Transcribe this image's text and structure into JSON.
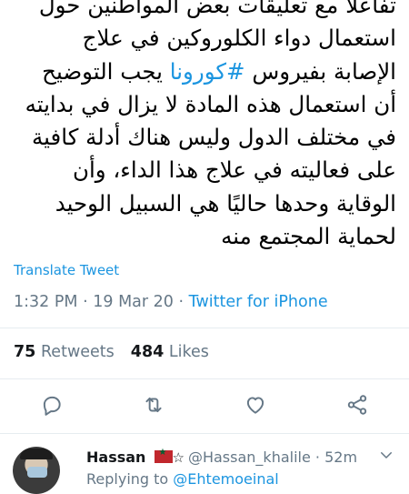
{
  "tweet": {
    "text_before_hashtag": "تفاعلا مع تعليقات بعض المواطنين حول استعمال دواء الكلوروكين في علاج الإصابة بفيروس ",
    "hashtag": "#كورونا",
    "text_after_hashtag": " يجب التوضيح أن استعمال هذه المادة لا يزال في بدايته في مختلف الدول وليس هناك أدلة كافية على فعاليته في علاج هذا الداء، وأن الوقاية وحدها حاليًا هي السبيل الوحيد لحماية المجتمع منه",
    "translate_label": "Translate Tweet",
    "time": "1:32 PM",
    "date": "19 Mar 20",
    "source": "Twitter for iPhone",
    "separator": "·"
  },
  "stats": {
    "retweets_count": "75",
    "retweets_label": "Retweets",
    "likes_count": "484",
    "likes_label": "Likes"
  },
  "actions": {
    "reply_icon": "reply-icon",
    "retweet_icon": "retweet-icon",
    "like_icon": "heart-icon",
    "share_icon": "share-icon"
  },
  "reply": {
    "name": "Hassan",
    "handle": "@Hassan_khalile",
    "time_ago": "52m",
    "separator": "·",
    "replying_to_label": "Replying to",
    "replying_to_handle": "@Ehtemoeinal"
  },
  "colors": {
    "accent": "#1b95e0",
    "secondary_text": "#657786",
    "divider": "#e6ecf0"
  }
}
